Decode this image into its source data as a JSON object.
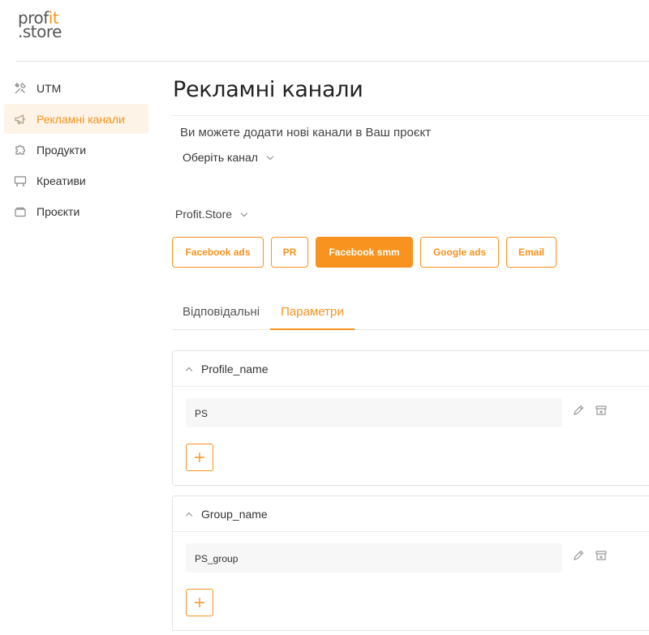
{
  "logo": {
    "line1": "prof",
    "line1_accent": "it",
    "line2": ".store"
  },
  "sidebar": {
    "items": [
      {
        "label": "UTM",
        "icon": "tools-icon",
        "active": false
      },
      {
        "label": "Рекламні канали",
        "icon": "megaphone-icon",
        "active": true
      },
      {
        "label": "Продукти",
        "icon": "puzzle-icon",
        "active": false
      },
      {
        "label": "Креативи",
        "icon": "billboard-icon",
        "active": false
      },
      {
        "label": "Проєкти",
        "icon": "folder-icon",
        "active": false
      }
    ]
  },
  "main": {
    "title": "Рекламні канали",
    "subtitle": "Ви можете додати нові канали в Ваш проєкт",
    "channel_select": "Оберіть канал",
    "project_select": "Profit.Store",
    "channels": [
      {
        "label": "Facebook ads",
        "active": false
      },
      {
        "label": "PR",
        "active": false
      },
      {
        "label": "Facebook smm",
        "active": true
      },
      {
        "label": "Google ads",
        "active": false
      },
      {
        "label": "Email",
        "active": false
      }
    ],
    "tabs": [
      {
        "label": "Відповідальні",
        "active": false
      },
      {
        "label": "Параметри",
        "active": true
      }
    ],
    "params": [
      {
        "name": "Profile_name",
        "values": [
          "PS"
        ]
      },
      {
        "name": "Group_name",
        "values": [
          "PS_group"
        ]
      }
    ]
  },
  "colors": {
    "accent": "#f7931e",
    "active_bg": "#fdf3e6",
    "value_bg": "#f7f7f7",
    "border": "#e3e3e3"
  }
}
